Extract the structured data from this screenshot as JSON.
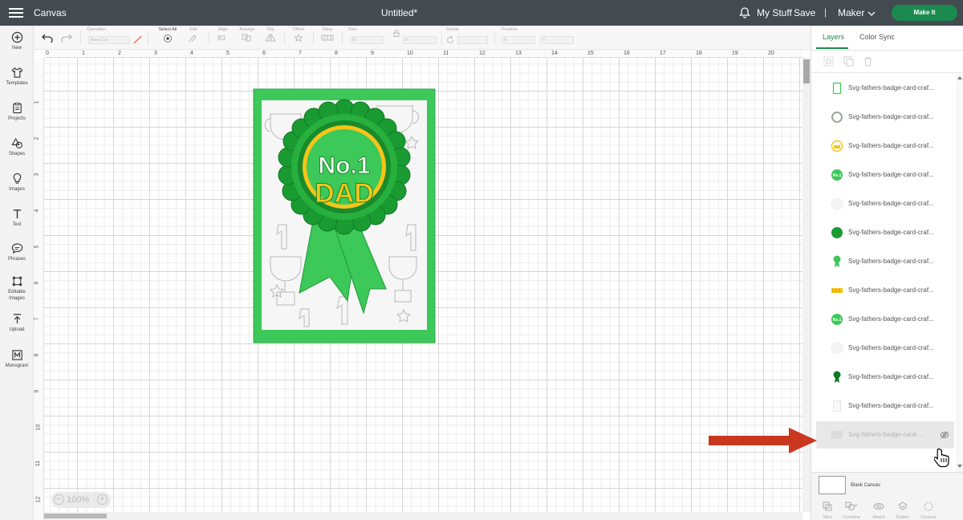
{
  "topbar": {
    "app_name": "Canvas",
    "document_title": "Untitled*",
    "my_stuff": "My Stuff",
    "save": "Save",
    "separator": "|",
    "machine": "Maker",
    "make_it": "Make It"
  },
  "sidebar": {
    "items": [
      {
        "label": "New",
        "icon": "plus-circle-icon"
      },
      {
        "label": "Templates",
        "icon": "shirt-icon"
      },
      {
        "label": "Projects",
        "icon": "clipboard-icon"
      },
      {
        "label": "Shapes",
        "icon": "shapes-icon"
      },
      {
        "label": "Images",
        "icon": "lightbulb-icon"
      },
      {
        "label": "Text",
        "icon": "text-t-icon"
      },
      {
        "label": "Phrases",
        "icon": "speech-bubble-icon"
      },
      {
        "label": "Editable Images",
        "icon": "editable-image-icon"
      },
      {
        "label": "Upload",
        "icon": "upload-icon"
      },
      {
        "label": "Monogram",
        "icon": "monogram-icon"
      }
    ]
  },
  "toolbar": {
    "operation_label": "Operation",
    "operation_value": "Basic Cut",
    "select_all": "Select All",
    "edit": "Edit",
    "align": "Align",
    "arrange": "Arrange",
    "flip": "Flip",
    "offset": "Offset",
    "warp": "Warp",
    "size": "Size",
    "size_w": "W",
    "size_h": "H",
    "rotate": "Rotate",
    "position": "Position",
    "pos_x": "X",
    "pos_y": "Y"
  },
  "rulers": {
    "top": [
      "0",
      "1",
      "2",
      "3",
      "4",
      "5",
      "6",
      "7",
      "8",
      "9",
      "10",
      "11",
      "12",
      "13",
      "14",
      "15",
      "16",
      "17",
      "18",
      "19",
      "20"
    ],
    "left": [
      "1",
      "2",
      "3",
      "4",
      "5",
      "6",
      "7",
      "8",
      "9",
      "10",
      "11",
      "12"
    ]
  },
  "zoom": {
    "value": "100%",
    "minus": "−",
    "plus": "+"
  },
  "card": {
    "line1": "No.1",
    "line2": "DAD"
  },
  "right_panel": {
    "tabs": [
      "Layers",
      "Color Sync"
    ],
    "active_tab": "Layers",
    "layers": [
      {
        "name": "Svg-fathers-badge-card-craf...",
        "thumb": "green-outline-rect"
      },
      {
        "name": "Svg-fathers-badge-card-craf...",
        "thumb": "grey-ring"
      },
      {
        "name": "Svg-fathers-badge-card-craf...",
        "thumb": "yellow-dad-circle"
      },
      {
        "name": "Svg-fathers-badge-card-craf...",
        "thumb": "green-no1-circle"
      },
      {
        "name": "Svg-fathers-badge-card-craf...",
        "thumb": "white-circle"
      },
      {
        "name": "Svg-fathers-badge-card-craf...",
        "thumb": "dark-green-circle"
      },
      {
        "name": "Svg-fathers-badge-card-craf...",
        "thumb": "green-ribbon"
      },
      {
        "name": "Svg-fathers-badge-card-craf...",
        "thumb": "yellow-dad-text"
      },
      {
        "name": "Svg-fathers-badge-card-craf...",
        "thumb": "green-no1-circle"
      },
      {
        "name": "Svg-fathers-badge-card-craf...",
        "thumb": "white-circle"
      },
      {
        "name": "Svg-fathers-badge-card-craf...",
        "thumb": "dark-green-ribbon"
      },
      {
        "name": "Svg-fathers-badge-card-craf...",
        "thumb": "white-card"
      },
      {
        "name": "Svg-fathers-badge-card-...",
        "thumb": "grey-rect",
        "selected": true,
        "hidden": true
      }
    ],
    "blank_canvas": "Blank Canvas",
    "bottom_tools": [
      "Slice",
      "Combine",
      "Attach",
      "Flatten",
      "Contour"
    ]
  },
  "colors": {
    "topbar": "#434a50",
    "make_it": "#1a8a4e",
    "card_green": "#3dc85a",
    "rosette_dark": "#1a9b32",
    "rosette_mid": "#27b03d",
    "dad_yellow": "#f5c518",
    "arrow_red": "#c9371f"
  }
}
